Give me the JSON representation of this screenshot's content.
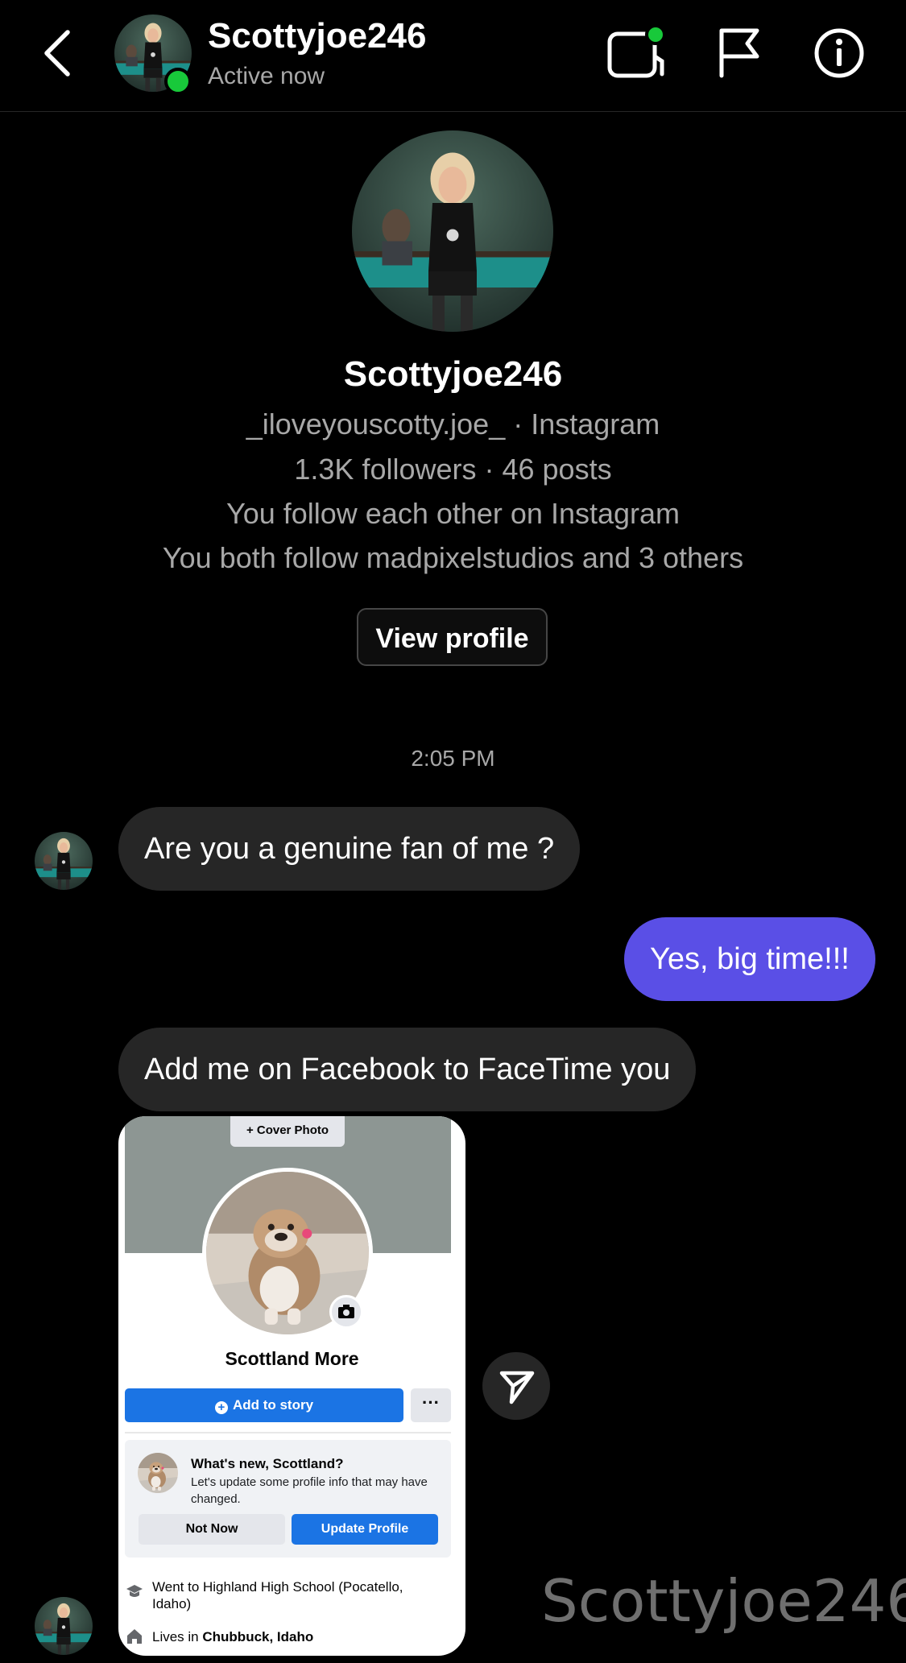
{
  "header": {
    "name": "Scottyjoe246",
    "status": "Active now"
  },
  "profile": {
    "name": "Scottyjoe246",
    "handle_line": "_iloveyouscotty.joe_ · Instagram",
    "stats_line": "1.3K followers · 46 posts",
    "follow_line": "You follow each other on Instagram",
    "mutual_line": "You both follow madpixelstudios and 3 others",
    "view_button": "View profile"
  },
  "conversation": {
    "timestamp": "2:05 PM",
    "messages": [
      {
        "from": "them",
        "text": "Are you a genuine fan of me ?"
      },
      {
        "from": "me",
        "text": "Yes, big time!!!"
      },
      {
        "from": "them",
        "text": "Add me on Facebook to FaceTime you"
      }
    ]
  },
  "shared_card": {
    "cover_button": "+ Cover Photo",
    "name": "Scottland More",
    "add_story": "Add to story",
    "more": "···",
    "whats_new_title": "What's new, Scottland?",
    "whats_new_text": "Let's update some profile info that may have changed.",
    "not_now": "Not Now",
    "update_profile": "Update Profile",
    "education": "Went to Highland High School (Pocatello, Idaho)",
    "lives_prefix": "Lives in ",
    "lives_place": "Chubbuck, Idaho"
  },
  "watermark": "Scottyjoe246",
  "colors": {
    "outgoing_bubble": "#5a4fe6",
    "incoming_bubble": "#262626",
    "online": "#18c93a",
    "facebook_blue": "#1b74e4"
  },
  "icons": [
    "back-icon",
    "video-call-icon",
    "flag-icon",
    "info-icon",
    "send-share-icon",
    "camera-icon",
    "school-icon",
    "home-icon"
  ]
}
